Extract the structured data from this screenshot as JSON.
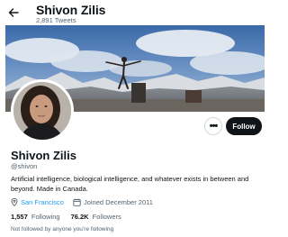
{
  "header": {
    "back_icon": "arrow-left-icon",
    "name": "Shivon Zilis",
    "tweet_count": "2,891 Tweets"
  },
  "actions": {
    "more_icon": "ellipsis-icon",
    "more_label": "•••",
    "follow_label": "Follow"
  },
  "profile": {
    "display_name": "Shivon Zilis",
    "handle": "@shivon",
    "bio": "Artificial intelligence, biological intelligence, and whatever exists in between and beyond. Made in Canada.",
    "location": "San Francisco",
    "location_icon": "location-pin-icon",
    "joined": "Joined December 2011",
    "joined_icon": "calendar-icon",
    "following_count": "1,557",
    "following_label": "Following",
    "followers_count": "76.2K",
    "followers_label": "Followers",
    "followed_note": "Not followed by anyone you’re following"
  },
  "colors": {
    "accent": "#1d9bf0",
    "text": "#0f1419",
    "secondary": "#536471",
    "button": "#0f1419"
  }
}
